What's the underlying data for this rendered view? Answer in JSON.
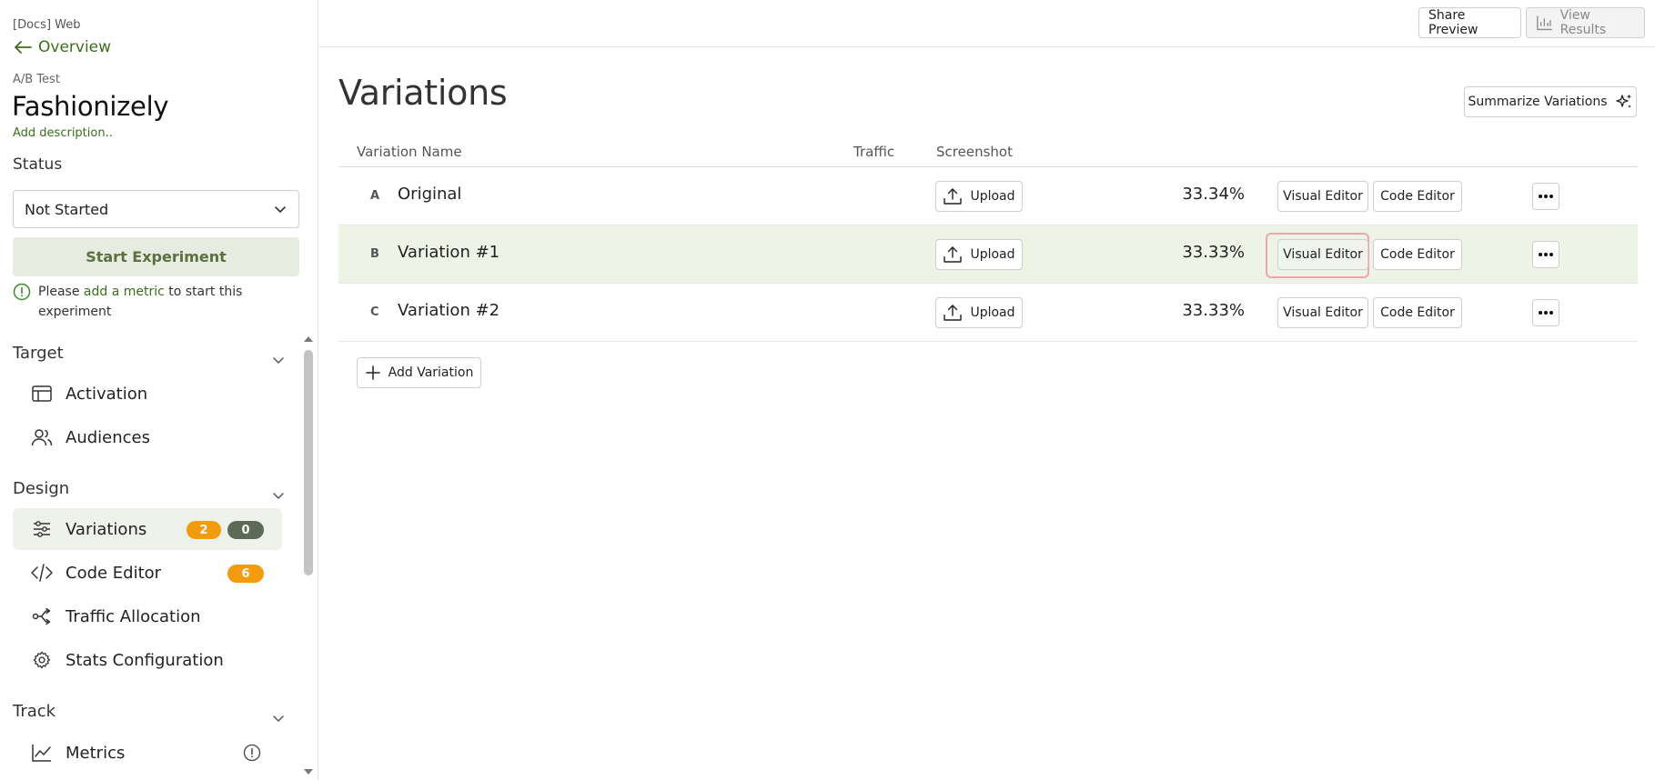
{
  "sidebar": {
    "project": "[Docs] Web",
    "back_label": "Overview",
    "type_label": "A/B Test",
    "experiment_name": "Fashionizely",
    "add_description": "Add description..",
    "status_label": "Status",
    "status_value": "Not Started",
    "start_button": "Start Experiment",
    "hint_prefix": "Please",
    "hint_link": "add a metric",
    "hint_suffix": "to start this experiment",
    "sections": {
      "target": "Target",
      "design": "Design",
      "track": "Track"
    },
    "items": {
      "activation": "Activation",
      "audiences": "Audiences",
      "variations": "Variations",
      "code_editor": "Code Editor",
      "traffic_allocation": "Traffic Allocation",
      "stats_configuration": "Stats Configuration",
      "metrics": "Metrics"
    },
    "badges": {
      "variations_a": "2",
      "variations_b": "0",
      "code_editor": "6"
    }
  },
  "topbar": {
    "share_preview": "Share Preview",
    "view_results": "View Results"
  },
  "main": {
    "title": "Variations",
    "summarize_button": "Summarize Variations",
    "columns": {
      "name": "Variation Name",
      "traffic": "Traffic",
      "screenshot": "Screenshot"
    },
    "rows": [
      {
        "letter": "A",
        "name": "Original",
        "traffic": "33.34%"
      },
      {
        "letter": "B",
        "name": "Variation #1",
        "traffic": "33.33%"
      },
      {
        "letter": "C",
        "name": "Variation #2",
        "traffic": "33.33%"
      }
    ],
    "upload_label": "Upload",
    "visual_editor_label": "Visual Editor",
    "code_editor_label": "Code Editor",
    "add_variation": "Add Variation"
  },
  "colors": {
    "brand_green": "#3c6e1e",
    "highlight_row": "#edf4e6",
    "badge_orange": "#f29b0f",
    "badge_dark": "#5c6a57",
    "focus_ring": "#f2a3b0"
  },
  "icons": {
    "back": "arrow-left-icon",
    "status": "chevron-down-icon",
    "warning": "exclamation-circle-icon",
    "activation": "layout-icon",
    "audiences": "users-icon",
    "variations": "sliders-icon",
    "code_editor": "code-icon",
    "traffic_allocation": "split-icon",
    "stats_configuration": "gear-icon",
    "metrics": "line-chart-icon",
    "view_results": "bar-chart-icon",
    "summarize": "sparkle-icon",
    "upload": "upload-icon",
    "more": "ellipsis-icon",
    "add": "plus-icon"
  }
}
